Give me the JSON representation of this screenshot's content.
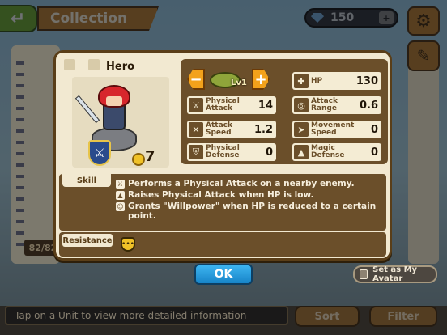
{
  "header": {
    "title": "Collection",
    "back_icon": "back-arrow-icon",
    "gems": "150",
    "gem_plus": "+"
  },
  "side": {
    "count": "82/82"
  },
  "popup": {
    "hero_name": "Hero",
    "cost": "7",
    "level": "Lv1",
    "minus_label": "−",
    "plus_label": "+",
    "stats": {
      "hp": {
        "label": "HP",
        "value": "130",
        "icon": "plus-cross-icon"
      },
      "physical_attack": {
        "label": "Physical Attack",
        "value": "14",
        "icon": "sword-icon"
      },
      "attack_range": {
        "label": "Attack Range",
        "value": "0.6",
        "icon": "target-icon"
      },
      "attack_speed": {
        "label": "Attack Speed",
        "value": "1.2",
        "icon": "crossed-swords-icon"
      },
      "movement_speed": {
        "label": "Movement Speed",
        "value": "0",
        "icon": "boot-icon"
      },
      "physical_defense": {
        "label": "Physical Defense",
        "value": "0",
        "icon": "shield-icon"
      },
      "magic_defense": {
        "label": "Magic Defense",
        "value": "0",
        "icon": "wizard-hat-icon"
      }
    },
    "skill_label": "Skill",
    "skills": [
      "Performs a Physical Attack on a nearby enemy.",
      "Raises Physical Attack when HP is low.",
      "Grants \"Willpower\" when HP is reduced to a certain point."
    ],
    "resistance_label": "Resistance"
  },
  "ok_label": "OK",
  "avatar_label": "Set as My Avatar",
  "hint": "Tap on a Unit to view more detailed information",
  "sort_label": "Sort",
  "filter_label": "Filter",
  "colors": {
    "frame": "#5a3e18",
    "panel": "#6b4f2a",
    "cream": "#f2e9d1",
    "ok_blue": "#1784c8",
    "accent_orange": "#f3a21b"
  }
}
